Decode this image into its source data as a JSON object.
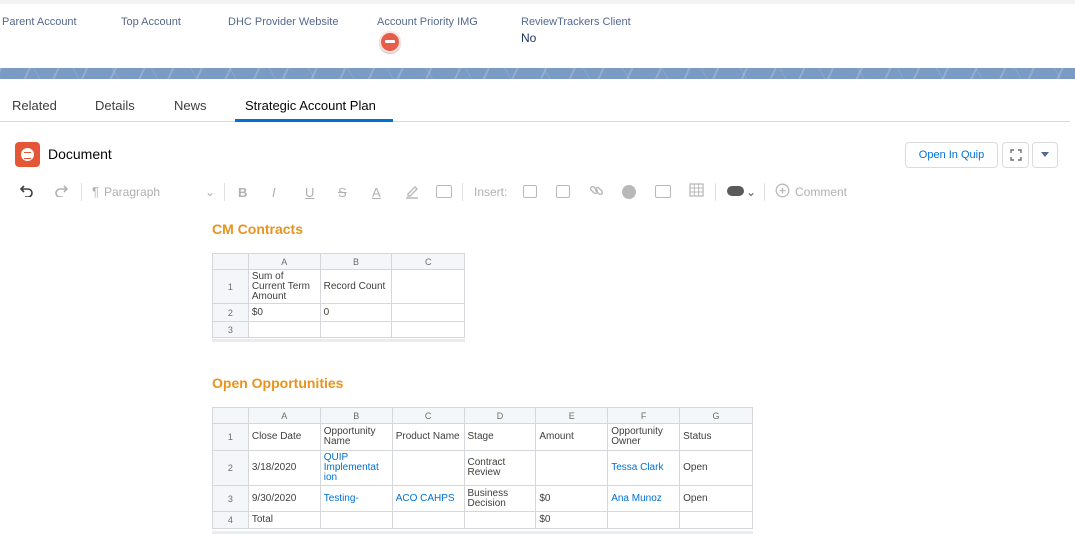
{
  "highlights": {
    "parent_account_label": "Parent Account",
    "top_account_label": "Top Account",
    "dhc_label": "DHC Provider Website",
    "priority_label": "Account Priority IMG",
    "reviewtrackers_label": "ReviewTrackers Client",
    "reviewtrackers_value": "No"
  },
  "tabs": [
    "Related",
    "Details",
    "News",
    "Strategic Account Plan"
  ],
  "active_tab": "Strategic Account Plan",
  "document": {
    "title": "Document",
    "open_in_quip": "Open In Quip"
  },
  "toolbar": {
    "paragraph": "Paragraph",
    "insert": "Insert:",
    "comment": "Comment",
    "bold": "B",
    "italic": "I",
    "underline": "U",
    "strike": "S",
    "text_color": "A"
  },
  "colors": {
    "accent": "#0070d2",
    "section_title": "#e8931e",
    "quip_orange": "#e55636",
    "priority_red": "#e85c4a"
  },
  "cm_contracts": {
    "title": "CM Contracts",
    "columns": [
      "A",
      "B",
      "C"
    ],
    "rows": [
      {
        "n": "1",
        "cells": [
          "Sum of Current Term Amount",
          "Record Count",
          ""
        ]
      },
      {
        "n": "2",
        "cells": [
          "$0",
          "0",
          ""
        ]
      },
      {
        "n": "3",
        "cells": [
          "",
          "",
          ""
        ]
      }
    ]
  },
  "open_opps": {
    "title": "Open Opportunities",
    "columns": [
      "A",
      "B",
      "C",
      "D",
      "E",
      "F",
      "G"
    ],
    "rows": [
      {
        "n": "1",
        "cells": [
          "Close Date",
          "Opportunity Name",
          "Product Name",
          "Stage",
          "Amount",
          "Opportunity Owner",
          "Status"
        ]
      },
      {
        "n": "2",
        "cells": [
          "3/18/2020",
          "QUIP Implementat ion",
          "",
          "Contract Review",
          "",
          "Tessa Clark",
          "Open"
        ]
      },
      {
        "n": "3",
        "cells": [
          "9/30/2020",
          "Testing-",
          "ACO CAHPS",
          "Business Decision",
          "$0",
          "Ana Munoz",
          "Open"
        ]
      },
      {
        "n": "4",
        "cells": [
          "Total",
          "",
          "",
          "",
          "$0",
          "",
          ""
        ]
      }
    ]
  }
}
